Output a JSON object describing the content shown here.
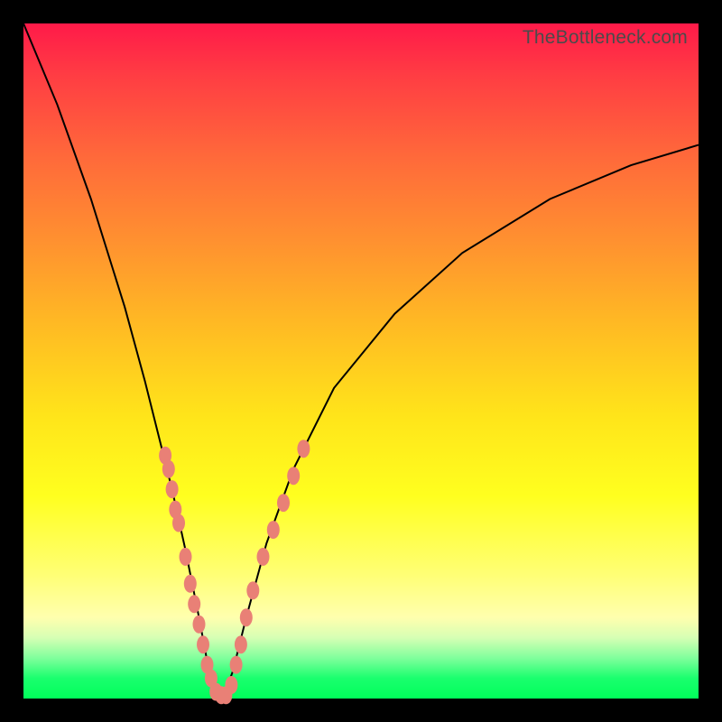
{
  "watermark": "TheBottleneck.com",
  "chart_data": {
    "type": "line",
    "title": "",
    "xlabel": "",
    "ylabel": "",
    "xlim": [
      0,
      100
    ],
    "ylim": [
      0,
      100
    ],
    "series": [
      {
        "name": "bottleneck-curve",
        "x": [
          0,
          5,
          10,
          15,
          18,
          20,
          22,
          24,
          26,
          27.5,
          28.5,
          29.5,
          31,
          33,
          36,
          40,
          46,
          55,
          65,
          78,
          90,
          100
        ],
        "y": [
          100,
          88,
          74,
          58,
          47,
          39,
          31,
          22,
          12,
          4,
          0,
          0,
          4,
          12,
          23,
          34,
          46,
          57,
          66,
          74,
          79,
          82
        ]
      }
    ],
    "annotations": {
      "cluster_points_left": [
        {
          "x": 21.0,
          "y": 36
        },
        {
          "x": 21.5,
          "y": 34
        },
        {
          "x": 22.0,
          "y": 31
        },
        {
          "x": 22.5,
          "y": 28
        },
        {
          "x": 23.0,
          "y": 26
        },
        {
          "x": 24.0,
          "y": 21
        },
        {
          "x": 24.7,
          "y": 17
        },
        {
          "x": 25.3,
          "y": 14
        },
        {
          "x": 26.0,
          "y": 11
        },
        {
          "x": 26.6,
          "y": 8
        },
        {
          "x": 27.2,
          "y": 5
        },
        {
          "x": 27.8,
          "y": 3
        },
        {
          "x": 28.5,
          "y": 1
        },
        {
          "x": 29.3,
          "y": 0.5
        }
      ],
      "cluster_points_right": [
        {
          "x": 30.0,
          "y": 0.5
        },
        {
          "x": 30.8,
          "y": 2
        },
        {
          "x": 31.5,
          "y": 5
        },
        {
          "x": 32.2,
          "y": 8
        },
        {
          "x": 33.0,
          "y": 12
        },
        {
          "x": 34.0,
          "y": 16
        },
        {
          "x": 35.5,
          "y": 21
        },
        {
          "x": 37.0,
          "y": 25
        },
        {
          "x": 38.5,
          "y": 29
        },
        {
          "x": 40.0,
          "y": 33
        },
        {
          "x": 41.5,
          "y": 37
        }
      ]
    }
  }
}
